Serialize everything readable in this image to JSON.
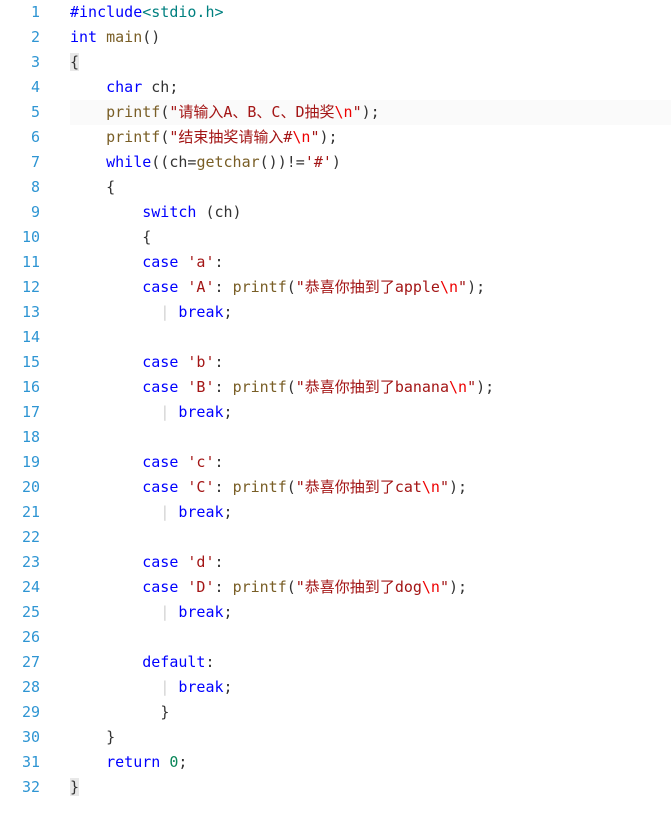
{
  "code": {
    "lines": [
      {
        "n": "1",
        "frags": [
          {
            "t": "#",
            "c": "c-pp"
          },
          {
            "t": "include",
            "c": "c-blue"
          },
          {
            "t": "<stdio.h>",
            "c": "c-green"
          }
        ]
      },
      {
        "n": "2",
        "frags": [
          {
            "t": "int",
            "c": "c-blue"
          },
          {
            "t": " ",
            "c": ""
          },
          {
            "t": "main",
            "c": "c-func"
          },
          {
            "t": "()",
            "c": "c-paren"
          }
        ]
      },
      {
        "n": "3",
        "frags": [
          {
            "t": "{",
            "c": "c-brace"
          }
        ]
      },
      {
        "n": "4",
        "frags": [
          {
            "t": "    ",
            "c": ""
          },
          {
            "t": "char",
            "c": "c-blue"
          },
          {
            "t": " ch;",
            "c": "c-text"
          }
        ]
      },
      {
        "n": "5",
        "hl": true,
        "frags": [
          {
            "t": "    ",
            "c": ""
          },
          {
            "t": "printf",
            "c": "c-func"
          },
          {
            "t": "(",
            "c": "c-paren"
          },
          {
            "t": "\"请输入A、B、C、D抽奖",
            "c": "c-str"
          },
          {
            "t": "\\n",
            "c": "c-esc"
          },
          {
            "t": "\"",
            "c": "c-str"
          },
          {
            "t": ");",
            "c": "c-paren"
          }
        ]
      },
      {
        "n": "6",
        "frags": [
          {
            "t": "    ",
            "c": ""
          },
          {
            "t": "printf",
            "c": "c-func"
          },
          {
            "t": "(",
            "c": "c-paren"
          },
          {
            "t": "\"结束抽奖请输入#",
            "c": "c-str"
          },
          {
            "t": "\\n",
            "c": "c-esc"
          },
          {
            "t": "\"",
            "c": "c-str"
          },
          {
            "t": ");",
            "c": "c-paren"
          }
        ]
      },
      {
        "n": "7",
        "frags": [
          {
            "t": "    ",
            "c": ""
          },
          {
            "t": "while",
            "c": "c-blue"
          },
          {
            "t": "((ch=",
            "c": "c-text"
          },
          {
            "t": "getchar",
            "c": "c-func"
          },
          {
            "t": "())!=",
            "c": "c-text"
          },
          {
            "t": "'#'",
            "c": "c-str"
          },
          {
            "t": ")",
            "c": "c-paren"
          }
        ]
      },
      {
        "n": "8",
        "frags": [
          {
            "t": "    {",
            "c": "c-text"
          }
        ]
      },
      {
        "n": "9",
        "frags": [
          {
            "t": "        ",
            "c": ""
          },
          {
            "t": "switch",
            "c": "c-blue"
          },
          {
            "t": " (ch)",
            "c": "c-text"
          }
        ]
      },
      {
        "n": "10",
        "frags": [
          {
            "t": "        {",
            "c": "c-text"
          }
        ]
      },
      {
        "n": "11",
        "frags": [
          {
            "t": "        ",
            "c": ""
          },
          {
            "t": "case",
            "c": "c-blue"
          },
          {
            "t": " ",
            "c": ""
          },
          {
            "t": "'a'",
            "c": "c-str"
          },
          {
            "t": ":",
            "c": "c-text"
          }
        ]
      },
      {
        "n": "12",
        "frags": [
          {
            "t": "        ",
            "c": ""
          },
          {
            "t": "case",
            "c": "c-blue"
          },
          {
            "t": " ",
            "c": ""
          },
          {
            "t": "'A'",
            "c": "c-str"
          },
          {
            "t": ": ",
            "c": "c-text"
          },
          {
            "t": "printf",
            "c": "c-func"
          },
          {
            "t": "(",
            "c": "c-paren"
          },
          {
            "t": "\"恭喜你抽到了apple",
            "c": "c-str"
          },
          {
            "t": "\\n",
            "c": "c-esc"
          },
          {
            "t": "\"",
            "c": "c-str"
          },
          {
            "t": ");",
            "c": "c-paren"
          }
        ]
      },
      {
        "n": "13",
        "frags": [
          {
            "t": "          ",
            "c": ""
          },
          {
            "t": "| ",
            "c": "c-guide"
          },
          {
            "t": "break",
            "c": "c-blue"
          },
          {
            "t": ";",
            "c": "c-text"
          }
        ]
      },
      {
        "n": "14",
        "frags": [
          {
            "t": "",
            "c": ""
          }
        ]
      },
      {
        "n": "15",
        "frags": [
          {
            "t": "        ",
            "c": ""
          },
          {
            "t": "case",
            "c": "c-blue"
          },
          {
            "t": " ",
            "c": ""
          },
          {
            "t": "'b'",
            "c": "c-str"
          },
          {
            "t": ":",
            "c": "c-text"
          }
        ]
      },
      {
        "n": "16",
        "frags": [
          {
            "t": "        ",
            "c": ""
          },
          {
            "t": "case",
            "c": "c-blue"
          },
          {
            "t": " ",
            "c": ""
          },
          {
            "t": "'B'",
            "c": "c-str"
          },
          {
            "t": ": ",
            "c": "c-text"
          },
          {
            "t": "printf",
            "c": "c-func"
          },
          {
            "t": "(",
            "c": "c-paren"
          },
          {
            "t": "\"恭喜你抽到了banana",
            "c": "c-str"
          },
          {
            "t": "\\n",
            "c": "c-esc"
          },
          {
            "t": "\"",
            "c": "c-str"
          },
          {
            "t": ");",
            "c": "c-paren"
          }
        ]
      },
      {
        "n": "17",
        "frags": [
          {
            "t": "          ",
            "c": ""
          },
          {
            "t": "| ",
            "c": "c-guide"
          },
          {
            "t": "break",
            "c": "c-blue"
          },
          {
            "t": ";",
            "c": "c-text"
          }
        ]
      },
      {
        "n": "18",
        "frags": [
          {
            "t": "",
            "c": ""
          }
        ]
      },
      {
        "n": "19",
        "frags": [
          {
            "t": "        ",
            "c": ""
          },
          {
            "t": "case",
            "c": "c-blue"
          },
          {
            "t": " ",
            "c": ""
          },
          {
            "t": "'c'",
            "c": "c-str"
          },
          {
            "t": ":",
            "c": "c-text"
          }
        ]
      },
      {
        "n": "20",
        "frags": [
          {
            "t": "        ",
            "c": ""
          },
          {
            "t": "case",
            "c": "c-blue"
          },
          {
            "t": " ",
            "c": ""
          },
          {
            "t": "'C'",
            "c": "c-str"
          },
          {
            "t": ": ",
            "c": "c-text"
          },
          {
            "t": "printf",
            "c": "c-func"
          },
          {
            "t": "(",
            "c": "c-paren"
          },
          {
            "t": "\"恭喜你抽到了cat",
            "c": "c-str"
          },
          {
            "t": "\\n",
            "c": "c-esc"
          },
          {
            "t": "\"",
            "c": "c-str"
          },
          {
            "t": ");",
            "c": "c-paren"
          }
        ]
      },
      {
        "n": "21",
        "frags": [
          {
            "t": "          ",
            "c": ""
          },
          {
            "t": "| ",
            "c": "c-guide"
          },
          {
            "t": "break",
            "c": "c-blue"
          },
          {
            "t": ";",
            "c": "c-text"
          }
        ]
      },
      {
        "n": "22",
        "frags": [
          {
            "t": "",
            "c": ""
          }
        ]
      },
      {
        "n": "23",
        "frags": [
          {
            "t": "        ",
            "c": ""
          },
          {
            "t": "case",
            "c": "c-blue"
          },
          {
            "t": " ",
            "c": ""
          },
          {
            "t": "'d'",
            "c": "c-str"
          },
          {
            "t": ":",
            "c": "c-text"
          }
        ]
      },
      {
        "n": "24",
        "frags": [
          {
            "t": "        ",
            "c": ""
          },
          {
            "t": "case",
            "c": "c-blue"
          },
          {
            "t": " ",
            "c": ""
          },
          {
            "t": "'D'",
            "c": "c-str"
          },
          {
            "t": ": ",
            "c": "c-text"
          },
          {
            "t": "printf",
            "c": "c-func"
          },
          {
            "t": "(",
            "c": "c-paren"
          },
          {
            "t": "\"恭喜你抽到了dog",
            "c": "c-str"
          },
          {
            "t": "\\n",
            "c": "c-esc"
          },
          {
            "t": "\"",
            "c": "c-str"
          },
          {
            "t": ");",
            "c": "c-paren"
          }
        ]
      },
      {
        "n": "25",
        "frags": [
          {
            "t": "          ",
            "c": ""
          },
          {
            "t": "| ",
            "c": "c-guide"
          },
          {
            "t": "break",
            "c": "c-blue"
          },
          {
            "t": ";",
            "c": "c-text"
          }
        ]
      },
      {
        "n": "26",
        "frags": [
          {
            "t": "",
            "c": ""
          }
        ]
      },
      {
        "n": "27",
        "frags": [
          {
            "t": "        ",
            "c": ""
          },
          {
            "t": "default",
            "c": "c-blue"
          },
          {
            "t": ":",
            "c": "c-text"
          }
        ]
      },
      {
        "n": "28",
        "frags": [
          {
            "t": "          ",
            "c": ""
          },
          {
            "t": "| ",
            "c": "c-guide"
          },
          {
            "t": "break",
            "c": "c-blue"
          },
          {
            "t": ";",
            "c": "c-text"
          }
        ]
      },
      {
        "n": "29",
        "frags": [
          {
            "t": "          ",
            "c": ""
          },
          {
            "t": "}",
            "c": "c-text"
          }
        ]
      },
      {
        "n": "30",
        "frags": [
          {
            "t": "    }",
            "c": "c-text"
          }
        ]
      },
      {
        "n": "31",
        "frags": [
          {
            "t": "    ",
            "c": ""
          },
          {
            "t": "return",
            "c": "c-blue"
          },
          {
            "t": " ",
            "c": ""
          },
          {
            "t": "0",
            "c": "c-num"
          },
          {
            "t": ";",
            "c": "c-text"
          }
        ]
      },
      {
        "n": "32",
        "frags": [
          {
            "t": "}",
            "c": "c-brace"
          }
        ]
      }
    ]
  }
}
